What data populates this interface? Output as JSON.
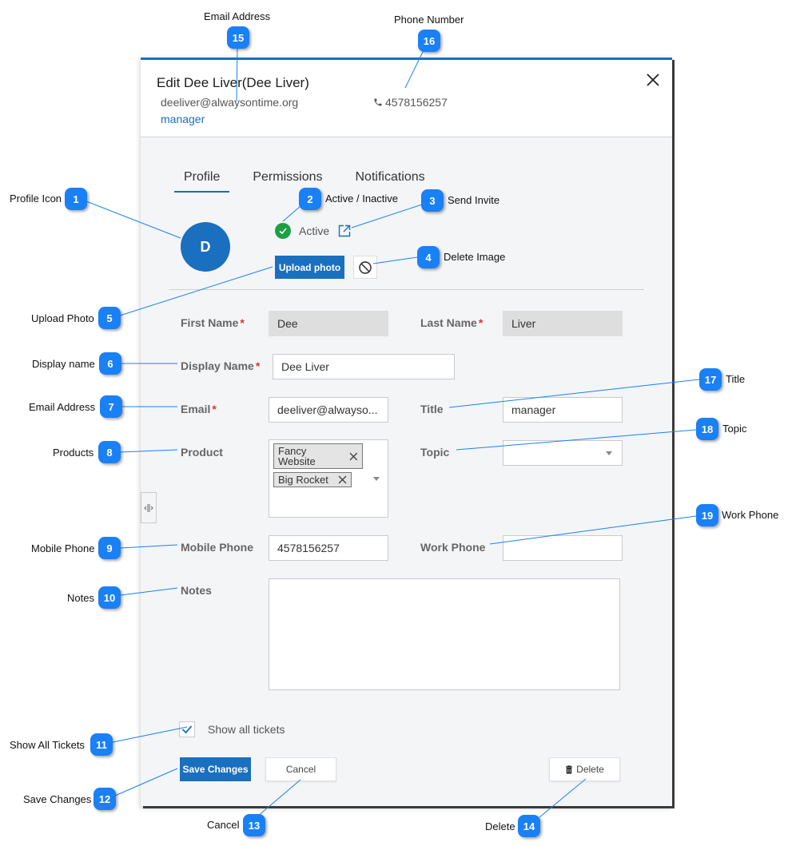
{
  "modal": {
    "title": "Edit Dee Liver(Dee Liver)",
    "header_email": "deeliver@alwaysontime.org",
    "header_title": "manager",
    "header_phone": "4578156257",
    "close_icon": "close-icon",
    "tabs": [
      {
        "label": "Profile",
        "active": true
      },
      {
        "label": "Permissions",
        "active": false
      },
      {
        "label": "Notifications",
        "active": false
      }
    ],
    "avatar_initial": "D",
    "status_label": "Active",
    "upload_photo_label": "Upload photo",
    "form": {
      "first_name": {
        "label": "First Name",
        "value": "Dee",
        "required": true
      },
      "last_name": {
        "label": "Last Name",
        "value": "Liver",
        "required": true
      },
      "display_name": {
        "label": "Display Name",
        "value": "Dee Liver",
        "required": true
      },
      "email": {
        "label": "Email",
        "value": "deeliver@alwayso...",
        "required": true
      },
      "title": {
        "label": "Title",
        "value": "manager"
      },
      "product": {
        "label": "Product",
        "chips": [
          "Fancy Website",
          "Big Rocket"
        ]
      },
      "topic": {
        "label": "Topic",
        "value": ""
      },
      "mobile_phone": {
        "label": "Mobile Phone",
        "value": "4578156257"
      },
      "work_phone": {
        "label": "Work Phone",
        "value": ""
      },
      "notes": {
        "label": "Notes",
        "value": ""
      },
      "required_marker": "*"
    },
    "show_all_tickets": {
      "label": "Show all tickets",
      "checked": true
    },
    "buttons": {
      "save": "Save Changes",
      "cancel": "Cancel",
      "delete": "Delete"
    }
  },
  "annotations": [
    {
      "n": "1",
      "text": "Profile Icon"
    },
    {
      "n": "2",
      "text": "Active / Inactive"
    },
    {
      "n": "3",
      "text": "Send Invite"
    },
    {
      "n": "4",
      "text": "Delete Image"
    },
    {
      "n": "5",
      "text": "Upload Photo"
    },
    {
      "n": "6",
      "text": "Display name"
    },
    {
      "n": "7",
      "text": "Email Address"
    },
    {
      "n": "8",
      "text": "Products"
    },
    {
      "n": "9",
      "text": "Mobile Phone"
    },
    {
      "n": "10",
      "text": "Notes"
    },
    {
      "n": "11",
      "text": "Show All Tickets"
    },
    {
      "n": "12",
      "text": "Save Changes"
    },
    {
      "n": "13",
      "text": "Cancel"
    },
    {
      "n": "14",
      "text": "Delete"
    },
    {
      "n": "15",
      "text": "Email Address"
    },
    {
      "n": "16",
      "text": "Phone Number"
    },
    {
      "n": "17",
      "text": "Title"
    },
    {
      "n": "18",
      "text": "Topic"
    },
    {
      "n": "19",
      "text": "Work Phone"
    }
  ],
  "colors": {
    "primary": "#1a6fbf",
    "callout": "#1a80f5",
    "active_status": "#1e9e45",
    "required": "#dd3333"
  }
}
